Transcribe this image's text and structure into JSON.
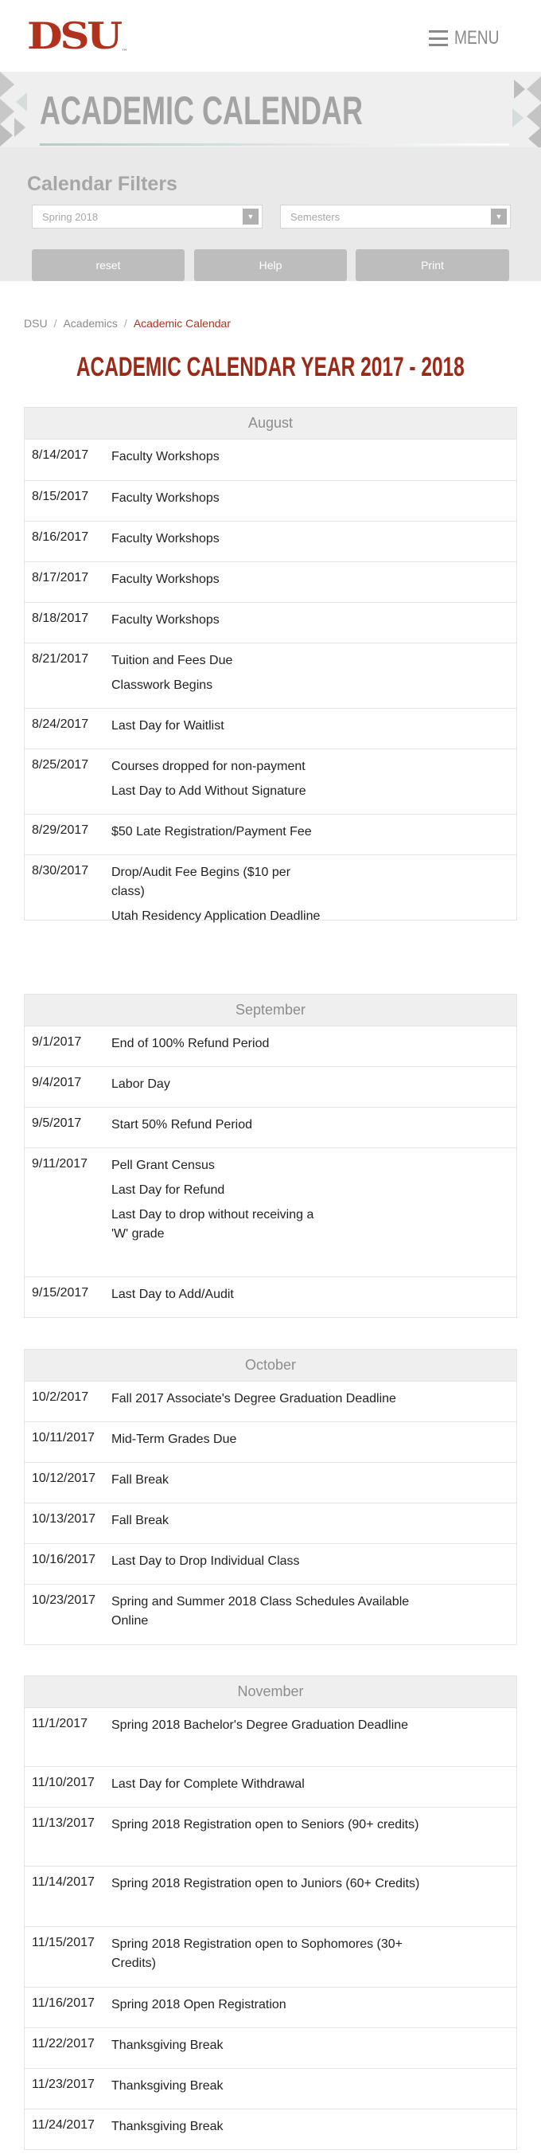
{
  "header": {
    "logo_text": "DSU",
    "logo_tm": "™",
    "menu_label": "MENU"
  },
  "banner": {
    "title": "ACADEMIC CALENDAR"
  },
  "filters": {
    "title": "Calendar Filters",
    "term_select": "Spring 2018",
    "type_select": "Semesters",
    "reset_label": "reset",
    "help_label": "Help",
    "print_label": "Print"
  },
  "breadcrumb": {
    "home": "DSU",
    "section": "Academics",
    "current": "Academic Calendar",
    "sep": "/"
  },
  "page_title": "ACADEMIC CALENDAR YEAR 2017 - 2018",
  "months": [
    {
      "name": "August",
      "rows": [
        {
          "date": "8/14/2017",
          "events": [
            "Faculty Workshops"
          ]
        },
        {
          "date": "8/15/2017",
          "events": [
            "Faculty Workshops"
          ]
        },
        {
          "date": "8/16/2017",
          "events": [
            "Faculty Workshops"
          ]
        },
        {
          "date": "8/17/2017",
          "events": [
            "Faculty Workshops"
          ]
        },
        {
          "date": "8/18/2017",
          "events": [
            "Faculty Workshops"
          ]
        },
        {
          "date": "8/21/2017",
          "events": [
            "Tuition and Fees Due",
            "Classwork Begins"
          ]
        },
        {
          "date": "8/24/2017",
          "events": [
            "Last Day for Waitlist"
          ]
        },
        {
          "date": "8/25/2017",
          "events": [
            "Courses dropped for non-payment",
            "Last Day to Add Without Signature"
          ]
        },
        {
          "date": "8/29/2017",
          "events": [
            "$50 Late Registration/Payment Fee"
          ]
        },
        {
          "date": "8/30/2017",
          "events": [
            "Drop/Audit Fee Begins ($10 per class)",
            "Utah Residency Application Deadline"
          ]
        }
      ]
    },
    {
      "name": "September",
      "rows": [
        {
          "date": "9/1/2017",
          "events": [
            "End of 100% Refund Period"
          ]
        },
        {
          "date": "9/4/2017",
          "events": [
            "Labor Day"
          ]
        },
        {
          "date": "9/5/2017",
          "events": [
            "Start 50% Refund Period"
          ]
        },
        {
          "date": "9/11/2017",
          "events": [
            "Pell Grant Census",
            "Last Day for Refund",
            "Last Day to drop without receiving a 'W' grade"
          ]
        },
        {
          "date": "9/15/2017",
          "events": [
            "Last Day to Add/Audit"
          ]
        }
      ]
    },
    {
      "name": "October",
      "rows": [
        {
          "date": "10/2/2017",
          "events": [
            "Fall 2017 Associate's Degree Graduation Deadline"
          ]
        },
        {
          "date": "10/11/2017",
          "events": [
            "Mid-Term Grades Due"
          ]
        },
        {
          "date": "10/12/2017",
          "events": [
            "Fall Break"
          ]
        },
        {
          "date": "10/13/2017",
          "events": [
            "Fall Break"
          ]
        },
        {
          "date": "10/16/2017",
          "events": [
            "Last Day to Drop Individual Class"
          ]
        },
        {
          "date": "10/23/2017",
          "events": [
            "Spring and Summer 2018 Class Schedules Available Online"
          ]
        }
      ]
    },
    {
      "name": "November",
      "rows": [
        {
          "date": "11/1/2017",
          "events": [
            "Spring 2018 Bachelor's Degree Graduation Deadline"
          ]
        },
        {
          "date": "11/10/2017",
          "events": [
            "Last Day for Complete Withdrawal"
          ]
        },
        {
          "date": "11/13/2017",
          "events": [
            "Spring 2018 Registration open to Seniors (90+ credits)"
          ]
        },
        {
          "date": "11/14/2017",
          "events": [
            "Spring 2018 Registration open to Juniors (60+ Credits)"
          ]
        },
        {
          "date": "11/15/2017",
          "events": [
            "Spring 2018 Registration open to Sophomores (30+ Credits)"
          ]
        },
        {
          "date": "11/16/2017",
          "events": [
            "Spring 2018 Open Registration"
          ]
        },
        {
          "date": "11/22/2017",
          "events": [
            "Thanksgiving Break"
          ]
        },
        {
          "date": "11/23/2017",
          "events": [
            "Thanksgiving Break"
          ]
        },
        {
          "date": "11/24/2017",
          "events": [
            "Thanksgiving Break"
          ]
        }
      ]
    }
  ]
}
